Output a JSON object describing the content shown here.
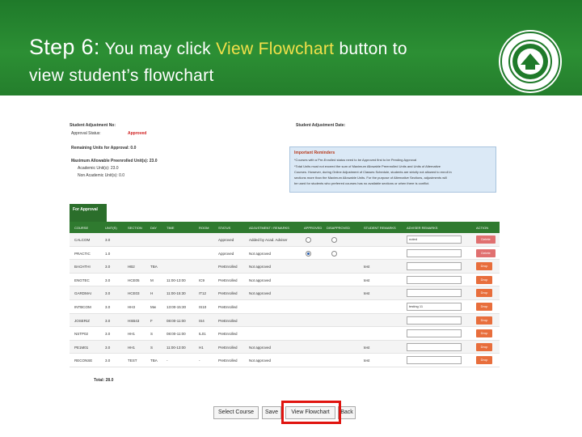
{
  "header": {
    "step": "Step 6:",
    "line1_a": "You may click",
    "line1_highlight": "View Flowchart",
    "line1_b": "button to",
    "line2": "view student’s flowchart"
  },
  "screen": {
    "student_adjustment_no": "Student Adjustment No:",
    "approval_status_label": "Approval Status:",
    "approval_status": "Approved",
    "student_adjustment_date": "Student Adjustment Date:",
    "remaining_units": "Remaining Units for Approval: 0.0",
    "max_units": "Maximum Allowable Preenrolled Unit(s): 23.0",
    "academic_units": "Academic Unit(s): 23.0",
    "non_academic_units": "Non Academic Unit(s): 0.0",
    "notice_title": "Important Reminders",
    "notice_lines": [
      "*Courses with a Pre-Enrolled status need to be Approved first to be Pending Approval",
      "*Total Units must not exceed the sum of Maximum Allowable Preenrolled Units and Units of Alternative",
      "Courses. However, during Online Adjustment of Classes Schedule, students are strictly not allowed to enroll in",
      "sections more than the Maximum Allowable Units. For the purpose of Alternative Sections, adjustments will",
      "be used for students who preferred courses has no available sections or when there is conflict."
    ],
    "approval_tab": "For Approval",
    "columns": [
      "COURSE",
      "UNIT(S)",
      "SECTION",
      "DAY",
      "TIME",
      "ROOM",
      "STATUS",
      "ADJUSTMENT / REMARKS",
      "APPROVED",
      "DISAPPROVED",
      "STUDENT REMARKS",
      "ADVISER REMARKS",
      "ACTION"
    ],
    "rows": [
      {
        "course": "CALCOM",
        "units": "3.0",
        "section": "",
        "day": "",
        "time": "",
        "room": "",
        "status": "Approved",
        "remarks": "Added by Acad. Adviser",
        "student_remarks": "",
        "adviser_remarks": "noted",
        "action": "Delete"
      },
      {
        "course": "PRACTIC",
        "units": "1.0",
        "section": "",
        "day": "",
        "time": "",
        "room": "",
        "status": "Approved",
        "remarks": "Not approved",
        "student_remarks": "",
        "adviser_remarks": "",
        "action": "Delete"
      },
      {
        "course": "BACHTHI",
        "units": "3.0",
        "section": "HB2",
        "day": "TBA",
        "time": "",
        "room": "",
        "status": "PreEnrolled",
        "remarks": "Not approved",
        "student_remarks": "test",
        "adviser_remarks": "",
        "action": "Drop"
      },
      {
        "course": "ENGTEC",
        "units": "3.0",
        "section": "HCE05",
        "day": "M",
        "time": "11:00-13:00",
        "room": "IC9",
        "status": "PreEnrolled",
        "remarks": "Not approved",
        "student_remarks": "test",
        "adviser_remarks": "",
        "action": "Drop"
      },
      {
        "course": "GARDMAI",
        "units": "3.0",
        "section": "HCE03",
        "day": "H",
        "time": "11:00-15:30",
        "room": "IT12",
        "status": "PreEnrolled",
        "remarks": "Not approved",
        "student_remarks": "test",
        "adviser_remarks": "",
        "action": "Drop"
      },
      {
        "course": "INTBCOM",
        "units": "3.0",
        "section": "HH3",
        "day": "Mw",
        "time": "13:00-15:30",
        "room": "IS10",
        "status": "PreEnrolled",
        "remarks": "",
        "student_remarks": "",
        "adviser_remarks": "testing 11",
        "action": "Drop"
      },
      {
        "course": "JOSERIZ",
        "units": "3.0",
        "section": "HSB43",
        "day": "F",
        "time": "08:00-11:00",
        "room": "IS4",
        "status": "PreEnrolled",
        "remarks": "",
        "student_remarks": "",
        "adviser_remarks": "",
        "action": "Drop"
      },
      {
        "course": "NSTP02",
        "units": "3.0",
        "section": "HH1",
        "day": "S",
        "time": "08:00-11:00",
        "room": "IL01",
        "status": "PreEnrolled",
        "remarks": "",
        "student_remarks": "",
        "adviser_remarks": "",
        "action": "Drop"
      },
      {
        "course": "PE1M01",
        "units": "3.0",
        "section": "HH1",
        "day": "S",
        "time": "11:00-13:00",
        "room": "H1",
        "status": "PreEnrolled",
        "remarks": "Not approved",
        "student_remarks": "test",
        "adviser_remarks": "",
        "action": "Drop"
      },
      {
        "course": "RECONSE",
        "units": "3.0",
        "section": "TEST",
        "day": "TBA",
        "time": "-",
        "room": "-",
        "status": "PreEnrolled",
        "remarks": "Not approved",
        "student_remarks": "test",
        "adviser_remarks": "",
        "action": "Drop"
      }
    ],
    "total": "Total: 28.0"
  },
  "buttons": {
    "select_course": "Select Course",
    "save": "Save",
    "view_flowchart": "View Flowchart",
    "back": "Back"
  },
  "colors": {
    "banner": "#2c8f34",
    "highlight_text": "#f3e04a",
    "highlight_box": "#e0140f"
  }
}
